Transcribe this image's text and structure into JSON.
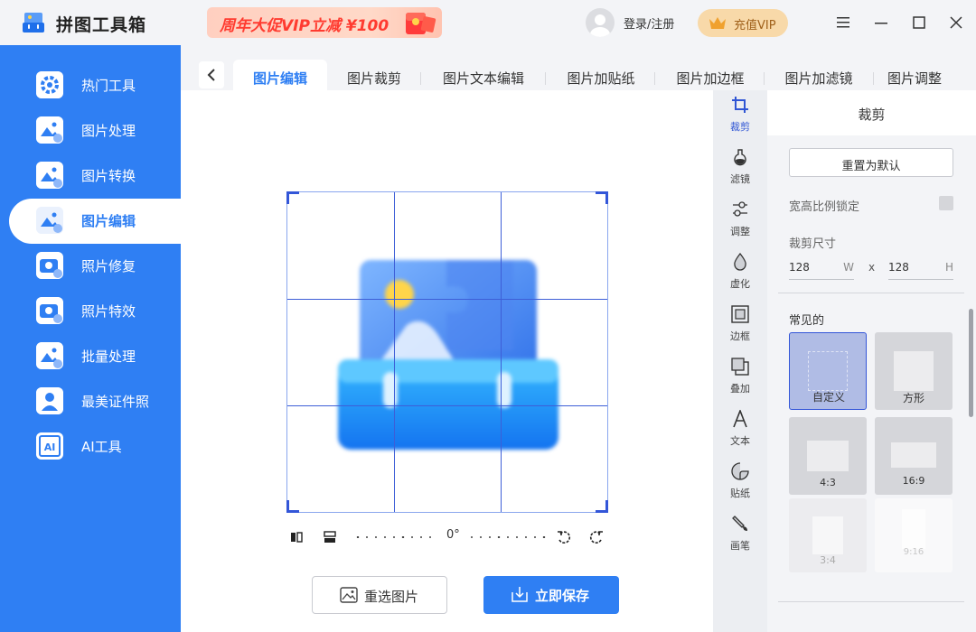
{
  "app": {
    "title": "拼图工具箱"
  },
  "promo": {
    "text": "周年大促VIP立减 ¥100"
  },
  "header": {
    "login": "登录/注册",
    "vip": "充值VIP"
  },
  "sidebar": {
    "items": [
      {
        "label": "热门工具",
        "icon": "gear-icon"
      },
      {
        "label": "图片处理",
        "icon": "image-process-icon"
      },
      {
        "label": "图片转换",
        "icon": "image-convert-icon"
      },
      {
        "label": "图片编辑",
        "icon": "image-edit-icon",
        "active": true
      },
      {
        "label": "照片修复",
        "icon": "camera-add-icon"
      },
      {
        "label": "照片特效",
        "icon": "camera-magic-icon"
      },
      {
        "label": "批量处理",
        "icon": "image-batch-icon"
      },
      {
        "label": "最美证件照",
        "icon": "id-photo-icon"
      },
      {
        "label": "AI工具",
        "icon": "ai-icon"
      }
    ]
  },
  "tabs": [
    {
      "label": "图片编辑",
      "active": true
    },
    {
      "label": "图片裁剪"
    },
    {
      "label": "图片文本编辑"
    },
    {
      "label": "图片加贴纸"
    },
    {
      "label": "图片加边框"
    },
    {
      "label": "图片加滤镜"
    },
    {
      "label": "图片调整"
    }
  ],
  "editor": {
    "rotation": "0°",
    "reselect": "重选图片",
    "save": "立即保存"
  },
  "tools": [
    {
      "label": "裁剪",
      "icon": "crop-icon",
      "active": true
    },
    {
      "label": "滤镜",
      "icon": "filter-icon"
    },
    {
      "label": "调整",
      "icon": "adjust-icon"
    },
    {
      "label": "虚化",
      "icon": "blur-icon"
    },
    {
      "label": "边框",
      "icon": "border-icon"
    },
    {
      "label": "叠加",
      "icon": "overlay-icon"
    },
    {
      "label": "文本",
      "icon": "text-icon"
    },
    {
      "label": "贴纸",
      "icon": "sticker-icon"
    },
    {
      "label": "画笔",
      "icon": "brush-icon"
    }
  ],
  "panel": {
    "title": "裁剪",
    "reset": "重置为默认",
    "lock_label": "宽高比例锁定",
    "size_label": "裁剪尺寸",
    "width": "128",
    "width_unit": "W",
    "x": "x",
    "height": "128",
    "height_unit": "H",
    "common_label": "常见的",
    "ratios": [
      {
        "label": "自定义",
        "active": true
      },
      {
        "label": "方形"
      },
      {
        "label": "4:3"
      },
      {
        "label": "16:9"
      },
      {
        "label": "3:4"
      },
      {
        "label": "9:16"
      }
    ]
  },
  "colors": {
    "accent": "#2f7ff3",
    "crop_grid": "#3d5ed7"
  }
}
